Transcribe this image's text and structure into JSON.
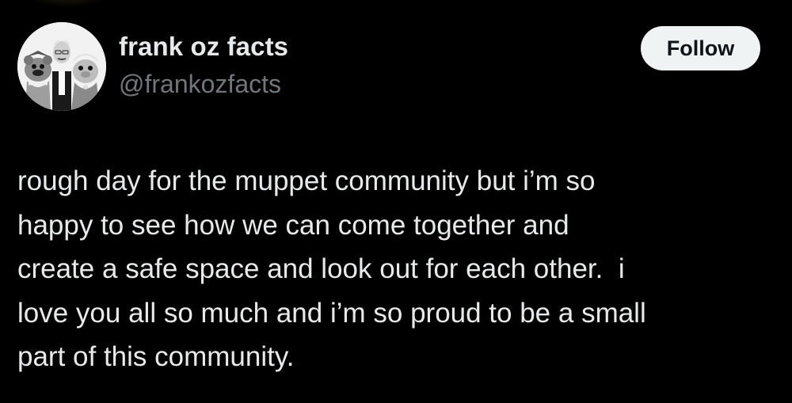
{
  "author": {
    "display_name": "frank oz facts",
    "handle": "@frankozfacts",
    "avatar_icon": "profile-photo"
  },
  "actions": {
    "follow_label": "Follow"
  },
  "tweet": {
    "lines": [
      "rough day for the muppet community but i’m so",
      "happy to see how we can come together and",
      "create a safe space and look out for each other.  i",
      "love you all so much and i’m so proud to be a small",
      "part of this community."
    ]
  },
  "colors": {
    "background": "#000000",
    "primary_text": "#e7e9ea",
    "secondary_text": "#71767b",
    "follow_bg": "#eff3f4",
    "follow_text": "#0f1419"
  }
}
